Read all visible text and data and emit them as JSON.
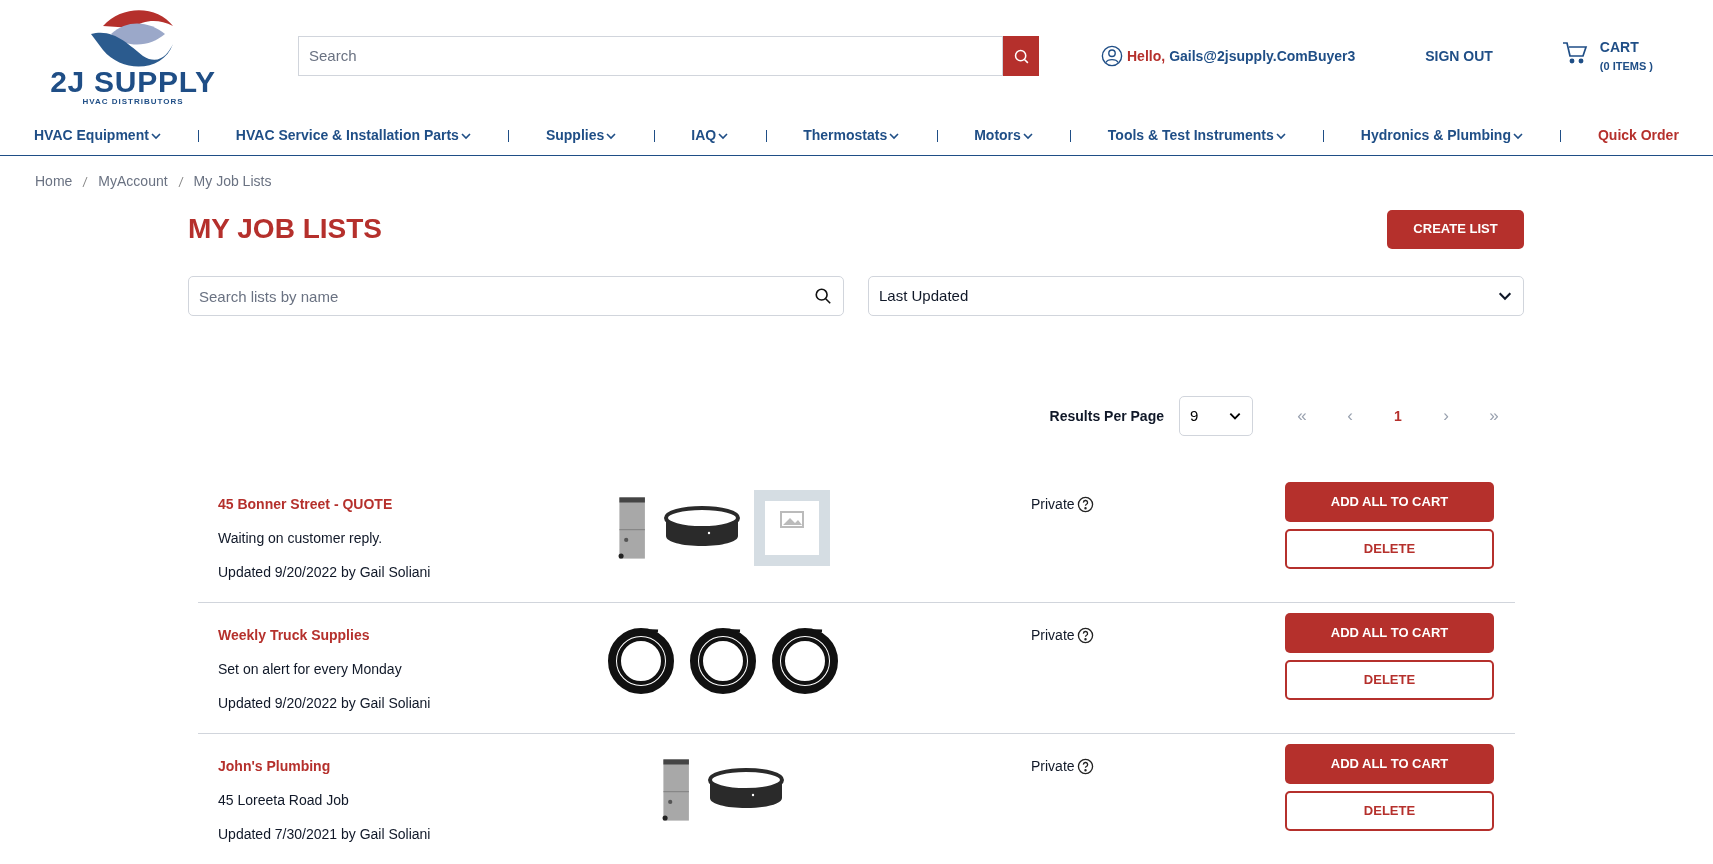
{
  "header": {
    "logo": {
      "name": "2J SUPPLY",
      "tagline": "HVAC DISTRIBUTORS"
    },
    "search": {
      "placeholder": "Search"
    },
    "user": {
      "greeting": "Hello,",
      "name": "Gails@2jsupply.ComBuyer3"
    },
    "sign_out": "SIGN OUT",
    "cart": {
      "label": "CART",
      "count": "(0 ITEMS )"
    }
  },
  "nav": [
    {
      "label": "HVAC Equipment",
      "kind": "menu"
    },
    {
      "label": "HVAC Service & Installation Parts",
      "kind": "menu"
    },
    {
      "label": "Supplies",
      "kind": "menu"
    },
    {
      "label": "IAQ",
      "kind": "menu"
    },
    {
      "label": "Thermostats",
      "kind": "menu"
    },
    {
      "label": "Motors",
      "kind": "menu"
    },
    {
      "label": "Tools & Test Instruments",
      "kind": "menu"
    },
    {
      "label": "Hydronics & Plumbing",
      "kind": "menu"
    },
    {
      "label": "Quick Order",
      "kind": "link"
    }
  ],
  "breadcrumb": [
    "Home",
    "MyAccount",
    "My Job Lists"
  ],
  "title": "MY JOB LISTS",
  "create_button": "CREATE LIST",
  "list_search": {
    "placeholder": "Search lists by name"
  },
  "sort": {
    "value": "Last Updated"
  },
  "results_per_page": {
    "label": "Results Per Page",
    "value": "9"
  },
  "pagination": {
    "first": {
      "label": "«",
      "disabled": true
    },
    "prev": {
      "label": "‹",
      "disabled": true
    },
    "pages": [
      {
        "label": "1",
        "selected": true
      }
    ],
    "next": {
      "label": "›",
      "disabled": true
    },
    "last": {
      "label": "»",
      "disabled": true
    }
  },
  "lists": [
    {
      "name": "45 Bonner Street - QUOTE",
      "note": "Waiting on customer reply.",
      "updated": "Updated 9/20/2022 by Gail Soliani",
      "images": [
        {
          "kind": "cabinet"
        },
        {
          "kind": "ring"
        },
        {
          "kind": "placeholder"
        }
      ],
      "visibility": "Private",
      "add_button": "ADD ALL TO CART",
      "delete_button": "DELETE"
    },
    {
      "name": "Weekly Truck Supplies",
      "note": "Set on alert for every Monday",
      "updated": "Updated 9/20/2022 by Gail Soliani",
      "images": [
        {
          "kind": "coil"
        },
        {
          "kind": "coil"
        },
        {
          "kind": "coil"
        }
      ],
      "visibility": "Private",
      "add_button": "ADD ALL TO CART",
      "delete_button": "DELETE"
    },
    {
      "name": "John's Plumbing",
      "note": "45 Loreeta Road Job",
      "updated": "Updated 7/30/2021 by Gail Soliani",
      "images": [
        {
          "kind": "cabinet"
        },
        {
          "kind": "ring"
        }
      ],
      "visibility": "Private",
      "add_button": "ADD ALL TO CART",
      "delete_button": "DELETE"
    }
  ]
}
